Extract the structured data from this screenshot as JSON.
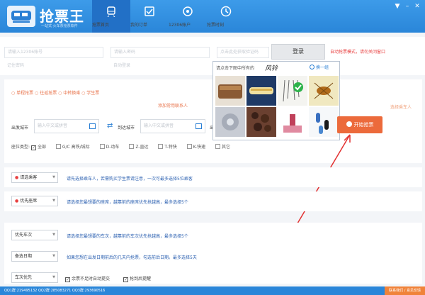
{
  "app": {
    "title": "抢票王",
    "subtitle": "一站式·火车票抢票软件"
  },
  "nav": [
    {
      "label": "抢票首页"
    },
    {
      "label": "我的订单"
    },
    {
      "label": "12306账户"
    },
    {
      "label": "抢票时刻"
    }
  ],
  "login": {
    "username_placeholder": "请输入12306账号",
    "password_placeholder": "请输入密码",
    "captcha_placeholder": "点击此处获取验证码",
    "remember": "记住密码",
    "auto_login": "自动登录",
    "login_button": "登录",
    "tip": "自动抢票模式，请勿关闭窗口"
  },
  "query": {
    "tabs": "○ 单程抢票   ○ 往返抢票   ○ 中转换乘   ○ 学生票",
    "add_passenger": "添加常用联系人",
    "right_hint": "选择乘车人",
    "from_label": "出发城市",
    "from_placeholder": "输入中文或拼音",
    "to_label": "到达城市",
    "to_placeholder": "输入中文或拼音",
    "date_label": "出",
    "seat_label": "座位类型:",
    "seats": [
      "全部",
      "G/C 高铁/城际",
      "D-动车",
      "Z-直达",
      "T-特快",
      "K-快速",
      "其它"
    ]
  },
  "captcha": {
    "title": "请点击下图中所有的",
    "word": "风铃",
    "refresh": "换一组",
    "images": [
      "pastry",
      "pencil-case",
      "wind-chime",
      "insect",
      "ceiling-lamp",
      "beans",
      "lipstick",
      "pills"
    ]
  },
  "start_button": "开始抢票",
  "passenger": {
    "label": "请选乘客",
    "desc": "请先选择乘车人，若需购买学生票请注意，一次可最多选择5位乘客"
  },
  "seat_pref": {
    "label": "优先座席",
    "desc": "请选择您最想要的座席，越靠前的座席优先抢越高，最多选择5个"
  },
  "train_pref": {
    "label": "优先车次",
    "desc": "请选择您最想要的车次，越靠前的车次优先抢越高，最多选择5个"
  },
  "date_pref": {
    "label": "备选日期",
    "desc": "如果您想在出发日期前后的几天内抢票，勾选前后日期。最多选择5天"
  },
  "options": {
    "mode": "车次优先",
    "opt1": "余票不足时自动提交",
    "opt2": "抢到后提醒"
  },
  "statusbar": {
    "text": "QQ1群:219495132   QQ2群:285083271   QQ3群:293690516",
    "right": "联系我们 / 意见反馈"
  },
  "colors": {
    "primary": "#2a86d9",
    "accent": "#ec6a3b",
    "alert": "#e84040"
  }
}
